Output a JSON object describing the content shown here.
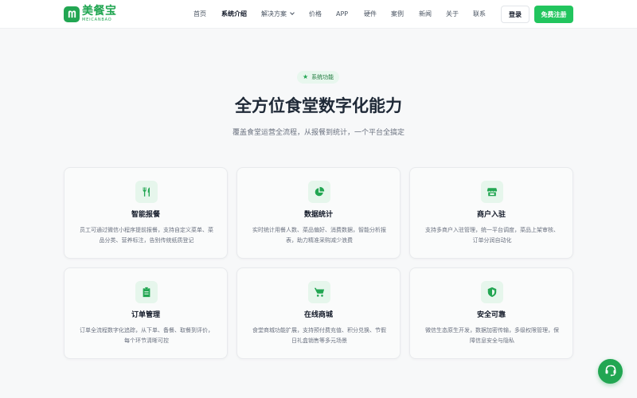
{
  "brand": {
    "name_cn": "美餐宝",
    "name_en": "MEICANBAO",
    "color": "#22a652"
  },
  "nav": {
    "items": [
      {
        "label": "首页"
      },
      {
        "label": "系统介绍",
        "active": true
      },
      {
        "label": "解决方案",
        "has_dropdown": true
      },
      {
        "label": "价格"
      },
      {
        "label": "APP"
      },
      {
        "label": "硬件"
      },
      {
        "label": "案例"
      },
      {
        "label": "新闻"
      },
      {
        "label": "关于"
      },
      {
        "label": "联系"
      }
    ],
    "login_label": "登录",
    "register_label": "免费注册"
  },
  "section": {
    "badge": "系统功能",
    "badge_icon": "star-icon",
    "title": "全方位食堂数字化能力",
    "subtitle": "覆盖食堂运营全流程，从报餐到统计，一个平台全搞定"
  },
  "features": [
    {
      "icon": "utensils-icon",
      "title": "智能报餐",
      "desc": "员工可通过微信小程序提前报餐，支持自定义菜单、菜品分类、营养标注，告别传统纸质登记"
    },
    {
      "icon": "pie-chart-icon",
      "title": "数据统计",
      "desc": "实时统计用餐人数、菜品偏好、消费数据，智能分析报表，助力精准采购减少浪费"
    },
    {
      "icon": "store-icon",
      "title": "商户入驻",
      "desc": "支持多商户入驻管理，统一平台调度，菜品上架审核、订单分润自动化"
    },
    {
      "icon": "clipboard-icon",
      "title": "订单管理",
      "desc": "订单全流程数字化追踪，从下单、备餐、取餐到评价，每个环节清晰可控"
    },
    {
      "icon": "cart-icon",
      "title": "在线商城",
      "desc": "食堂商城功能扩展，支持预付费充值、积分兑换、节假日礼盒销售等多元场景"
    },
    {
      "icon": "shield-icon",
      "title": "安全可靠",
      "desc": "微信生态原生开发，数据加密传输，多级权限管理，保障信息安全与隐私"
    }
  ],
  "support_icon": "headset-icon",
  "colors": {
    "accent": "#22c55e",
    "icon_bg": "#e6f6ec",
    "badge_bg": "#e8f7ee"
  }
}
